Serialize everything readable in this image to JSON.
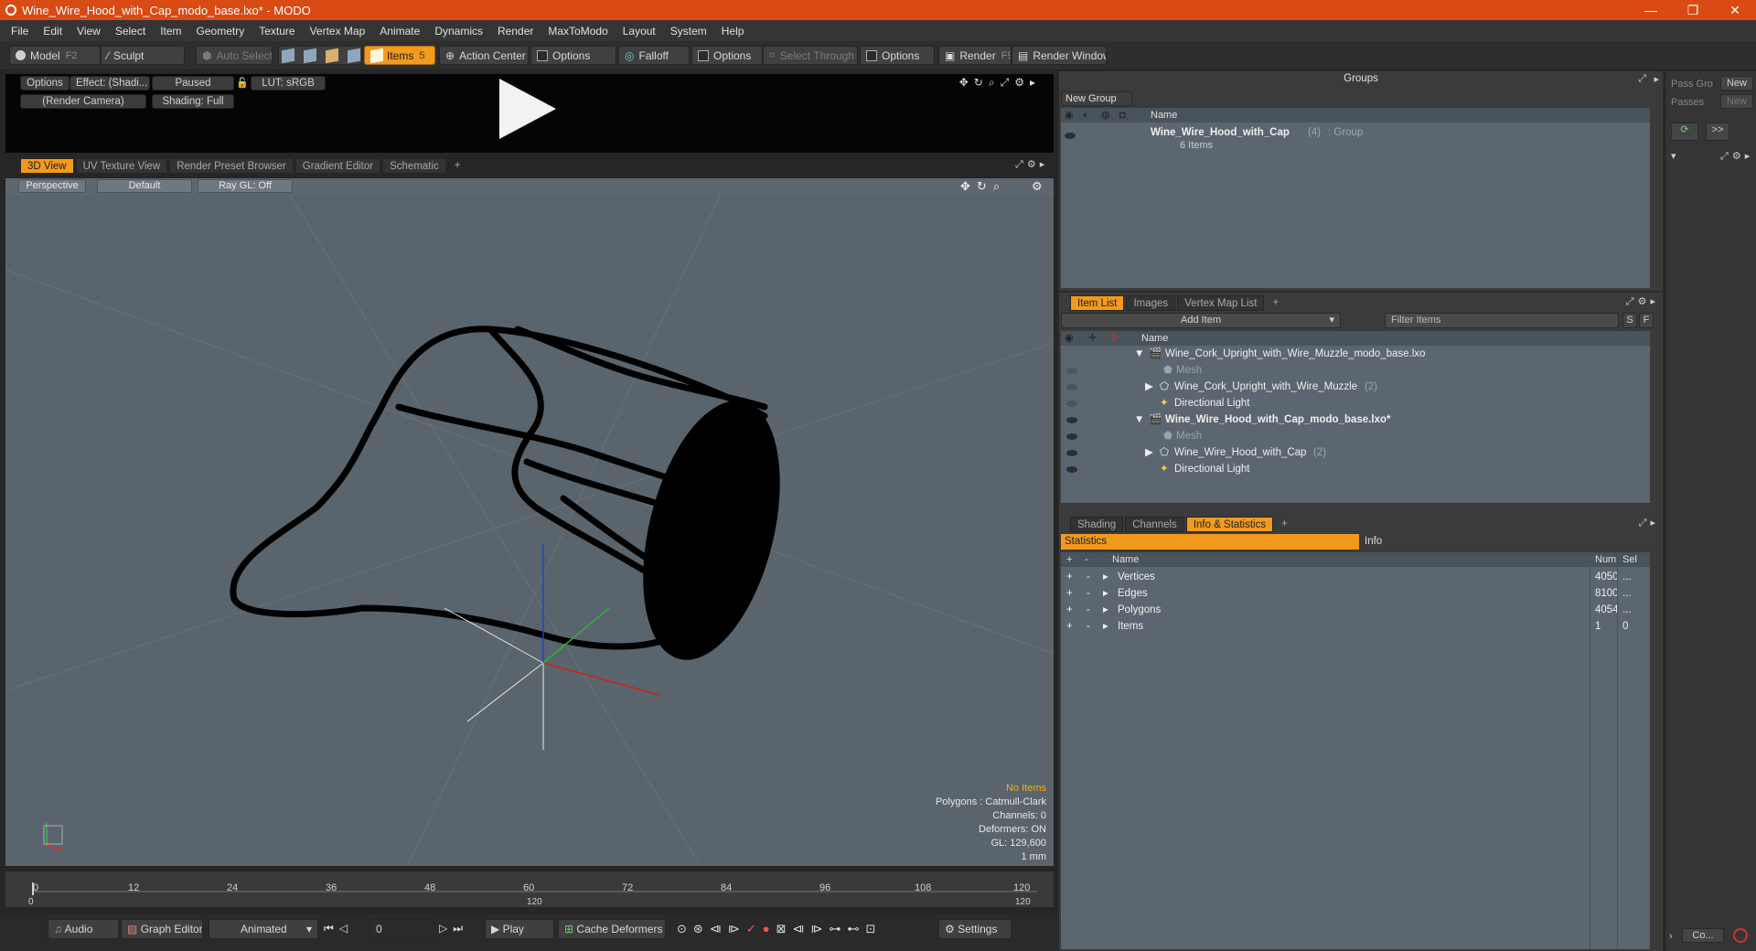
{
  "window": {
    "title": "Wine_Wire_Hood_with_Cap_modo_base.lxo* - MODO",
    "controls": [
      "—",
      "❐",
      "✕"
    ]
  },
  "menu": [
    "File",
    "Edit",
    "View",
    "Select",
    "Item",
    "Geometry",
    "Texture",
    "Vertex Map",
    "Animate",
    "Dynamics",
    "Render",
    "MaxToModo",
    "Layout",
    "System",
    "Help"
  ],
  "toolbar": {
    "model": "Model",
    "model_key": "F2",
    "sculpt": "Sculpt",
    "auto_select": "Auto Select",
    "items": "Items",
    "items_key": "5",
    "action_center": "Action Center",
    "options1": "Options",
    "falloff": "Falloff",
    "options2": "Options",
    "select_through": "Select Through",
    "options3": "Options",
    "render": "Render",
    "render_key": "F9",
    "render_window": "Render Window"
  },
  "preview": {
    "options": "Options",
    "effect": "Effect: (Shadi...",
    "paused": "Paused",
    "lut": "LUT: sRGB",
    "camera": "(Render Camera)",
    "shading": "Shading: Full"
  },
  "viewport_tabs": [
    "3D View",
    "UV Texture View",
    "Render Preset Browser",
    "Gradient Editor",
    "Schematic",
    "+"
  ],
  "viewport": {
    "perspective": "Perspective",
    "default": "Default",
    "raygl": "Ray GL: Off",
    "hud": {
      "no_items": "No Items",
      "polygons": "Polygons : Catmull-Clark",
      "channels": "Channels: 0",
      "deformers": "Deformers: ON",
      "gl": "GL: 129,600",
      "scale": "1 mm"
    }
  },
  "timeline": {
    "ticks": [
      "0",
      "12",
      "24",
      "36",
      "48",
      "60",
      "72",
      "84",
      "96",
      "108",
      "120"
    ],
    "range_start": "0",
    "range_mid": "120",
    "range_end": "120"
  },
  "bottom": {
    "audio": "Audio",
    "graph_editor": "Graph Editor",
    "animated": "Animated",
    "frame": "0",
    "play": "Play",
    "cache": "Cache Deformers",
    "settings": "Settings"
  },
  "groups": {
    "title": "Groups",
    "new_group": "New Group",
    "col_name": "Name",
    "group_name": "Wine_Wire_Hood_with_Cap",
    "group_count": "(4)",
    "group_type": ": Group",
    "items": "6 Items"
  },
  "pass": {
    "pass_groups": "Pass Gro",
    "passes": "Passes",
    "new1": "New",
    "new2": "New",
    "more": ">>",
    "co": "Co..."
  },
  "itemlist": {
    "tabs": [
      "Item List",
      "Images",
      "Vertex Map List",
      "+"
    ],
    "add_item": "Add Item",
    "filter": "Filter Items",
    "s": "S",
    "f": "F",
    "col_name": "Name",
    "rows": [
      {
        "label": "Wine_Cork_Upright_with_Wire_Muzzle_modo_base.lxo"
      },
      {
        "label": "Mesh"
      },
      {
        "label": "Wine_Cork_Upright_with_Wire_Muzzle",
        "count": "(2)"
      },
      {
        "label": "Directional Light"
      },
      {
        "label": "Wine_Wire_Hood_with_Cap_modo_base.lxo*"
      },
      {
        "label": "Mesh"
      },
      {
        "label": "Wine_Wire_Hood_with_Cap",
        "count": "(2)"
      },
      {
        "label": "Directional Light"
      }
    ]
  },
  "stats": {
    "tabs": [
      "Shading",
      "Channels",
      "Info & Statistics",
      "+"
    ],
    "statistics": "Statistics",
    "info": "Info",
    "col_name": "Name",
    "col_num": "Num",
    "col_sel": "Sel",
    "rows": [
      {
        "name": "Vertices",
        "num": "4050",
        "sel": "..."
      },
      {
        "name": "Edges",
        "num": "8100",
        "sel": "..."
      },
      {
        "name": "Polygons",
        "num": "4054",
        "sel": "..."
      },
      {
        "name": "Items",
        "num": "1",
        "sel": "0"
      }
    ]
  }
}
